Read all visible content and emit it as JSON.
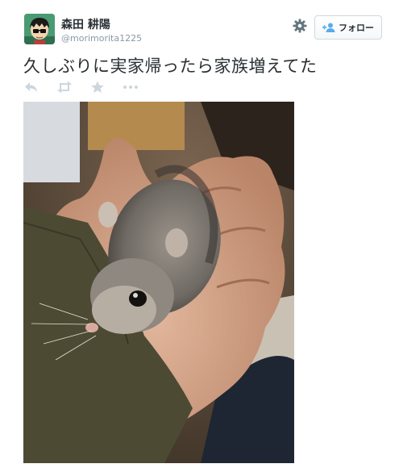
{
  "tweet": {
    "author": {
      "display_name": "森田 耕陽",
      "handle": "@morimorita1225",
      "avatar_icon": "cartoon-avatar"
    },
    "settings_icon": "gear-icon",
    "follow_button": {
      "label": "フォロー",
      "icon": "add-user-icon"
    },
    "text": "久しぶりに実家帰ったら家族増えてた",
    "actions": [
      "reply-icon",
      "retweet-icon",
      "favorite-icon",
      "more-icon"
    ],
    "photo": {
      "subject": "hamster-in-hand"
    }
  },
  "colors": {
    "text": "#292f33",
    "muted": "#8899a6",
    "icon": "#ccd6dd",
    "follow_icon": "#55acee"
  }
}
